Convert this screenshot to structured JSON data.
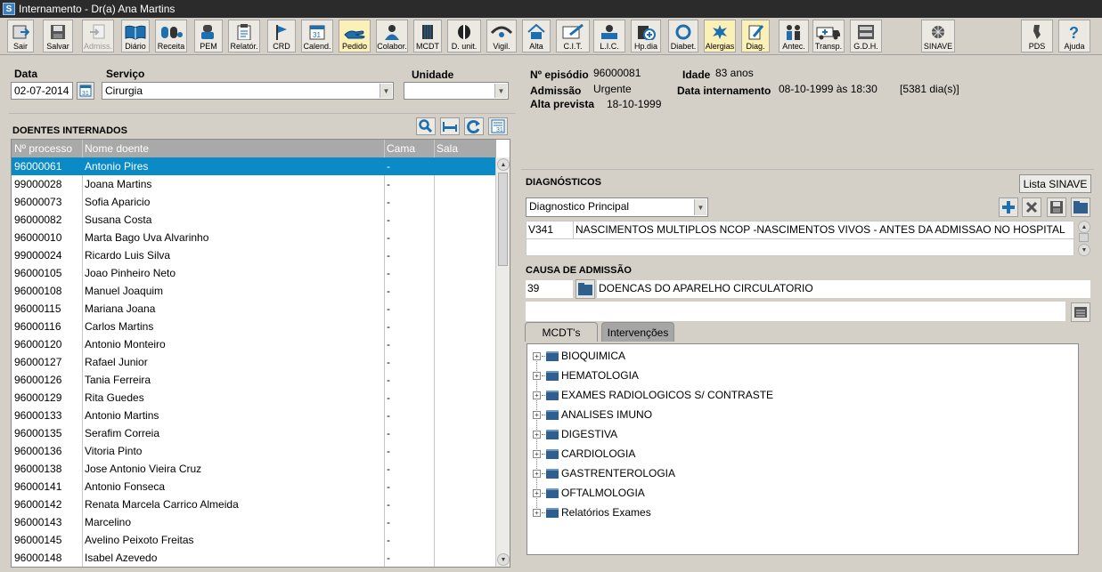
{
  "window": {
    "title": "Internamento - Dr(a) Ana Martins"
  },
  "toolbar": {
    "buttons": [
      {
        "label": "Sair",
        "icon": "exit-icon"
      },
      {
        "label": "Salvar",
        "icon": "save-icon"
      },
      {
        "label": "Admiss.",
        "icon": "admission-icon",
        "disabled": true
      },
      {
        "label": "Diário",
        "icon": "book-icon"
      },
      {
        "label": "Receita",
        "icon": "pills-icon"
      },
      {
        "label": "PEM",
        "icon": "prescription-icon"
      },
      {
        "label": "Relatór.",
        "icon": "clipboard-icon"
      },
      {
        "label": "CRD",
        "icon": "flag-icon"
      },
      {
        "label": "Calend.",
        "icon": "calendar-icon"
      },
      {
        "label": "Pedido",
        "icon": "hand-icon"
      },
      {
        "label": "Colabor.",
        "icon": "collaborator-icon"
      },
      {
        "label": "MCDT",
        "icon": "mcdt-icon"
      },
      {
        "label": "D. unit.",
        "icon": "unit-dose-icon"
      },
      {
        "label": "Vigil.",
        "icon": "eye-icon"
      },
      {
        "label": "Alta",
        "icon": "home-icon"
      },
      {
        "label": "C.I.T.",
        "icon": "cit-icon"
      },
      {
        "label": "L.I.C.",
        "icon": "lic-icon"
      },
      {
        "label": "Hp.dia",
        "icon": "hospital-day-icon"
      },
      {
        "label": "Diabet.",
        "icon": "ring-icon"
      },
      {
        "label": "Alergias",
        "icon": "allergy-icon"
      },
      {
        "label": "Diag.",
        "icon": "diagnosis-icon"
      },
      {
        "label": "Antec.",
        "icon": "family-icon"
      },
      {
        "label": "Transp.",
        "icon": "ambulance-icon"
      },
      {
        "label": "G.D.H.",
        "icon": "cabinet-icon"
      },
      {
        "label": "SINAVE",
        "icon": "sinave-icon"
      },
      {
        "label": "PDS",
        "icon": "pds-icon"
      },
      {
        "label": "Ajuda",
        "icon": "help-icon"
      }
    ]
  },
  "filters": {
    "date_label": "Data",
    "date_value": "02-07-2014",
    "service_label": "Serviço",
    "service_value": "Cirurgia",
    "unit_label": "Unidade",
    "unit_value": ""
  },
  "patients": {
    "title": "DOENTES INTERNADOS",
    "columns": [
      "Nº processo",
      "Nome doente",
      "Cama",
      "Sala"
    ],
    "rows": [
      {
        "id": "96000061",
        "name": "Antonio Pires",
        "bed": "-",
        "selected": true
      },
      {
        "id": "99000028",
        "name": "Joana Martins",
        "bed": "-"
      },
      {
        "id": "96000073",
        "name": "Sofia Aparicio",
        "bed": "-"
      },
      {
        "id": "96000082",
        "name": "Susana Costa",
        "bed": "-"
      },
      {
        "id": "96000010",
        "name": "Marta Bago Uva Alvarinho",
        "bed": "-"
      },
      {
        "id": "99000024",
        "name": "Ricardo Luis Silva",
        "bed": "-"
      },
      {
        "id": "96000105",
        "name": "Joao Pinheiro Neto",
        "bed": "-"
      },
      {
        "id": "96000108",
        "name": "Manuel Joaquim",
        "bed": "-"
      },
      {
        "id": "96000115",
        "name": "Mariana Joana",
        "bed": "-"
      },
      {
        "id": "96000116",
        "name": "Carlos Martins",
        "bed": "-"
      },
      {
        "id": "96000120",
        "name": "Antonio Monteiro",
        "bed": "-"
      },
      {
        "id": "96000127",
        "name": "Rafael Junior",
        "bed": "-"
      },
      {
        "id": "96000126",
        "name": "Tania Ferreira",
        "bed": "-"
      },
      {
        "id": "96000129",
        "name": "Rita Guedes",
        "bed": "-"
      },
      {
        "id": "96000133",
        "name": "Antonio Martins",
        "bed": "-"
      },
      {
        "id": "96000135",
        "name": "Serafim Correia",
        "bed": "-"
      },
      {
        "id": "96000136",
        "name": "Vitoria Pinto",
        "bed": "-"
      },
      {
        "id": "96000138",
        "name": "Jose Antonio Vieira Cruz",
        "bed": "-"
      },
      {
        "id": "96000141",
        "name": "Antonio Fonseca",
        "bed": "-"
      },
      {
        "id": "96000142",
        "name": "Renata Marcela Carrico Almeida",
        "bed": "-"
      },
      {
        "id": "96000143",
        "name": "Marcelino",
        "bed": "-"
      },
      {
        "id": "96000145",
        "name": "Avelino Peixoto Freitas",
        "bed": "-"
      },
      {
        "id": "96000148",
        "name": "Isabel Azevedo",
        "bed": "-"
      }
    ]
  },
  "episode": {
    "episode_label": "Nº episódio",
    "episode_value": "96000081",
    "age_label": "Idade",
    "age_value": "83 anos",
    "admission_label": "Admissão",
    "admission_value": "Urgente",
    "admission_date_label": "Data internamento",
    "admission_date_value": "08-10-1999 às 18:30",
    "days_value": "[5381 dia(s)]",
    "discharge_label": "Alta prevista",
    "discharge_value": "18-10-1999"
  },
  "diagnostics": {
    "title": "DIAGNÓSTICOS",
    "sinave_button": "Lista SINAVE",
    "type_value": "Diagnostico Principal",
    "code": "V341",
    "description": "NASCIMENTOS MULTIPLOS NCOP -NASCIMENTOS VIVOS - ANTES DA ADMISSAO NO HOSPITAL",
    "cause_title": "CAUSA DE ADMISSÃO",
    "cause_code": "39",
    "cause_description": "DOENCAS DO APARELHO CIRCULATORIO"
  },
  "tabs": {
    "mcdt": "MCDT's",
    "interventions": "Intervenções"
  },
  "tree": {
    "items": [
      "BIOQUIMICA",
      "HEMATOLOGIA",
      "EXAMES RADIOLOGICOS S/ CONTRASTE",
      "ANALISES IMUNO",
      "DIGESTIVA",
      "CARDIOLOGIA",
      "GASTRENTEROLOGIA",
      "OFTALMOLOGIA",
      "Relatórios Exames"
    ]
  },
  "colors": {
    "selection": "#0a8bc7",
    "header_gray": "#a9a9a9",
    "accent_blue": "#1d6fb0",
    "titlebar": "#2b2b2b"
  }
}
